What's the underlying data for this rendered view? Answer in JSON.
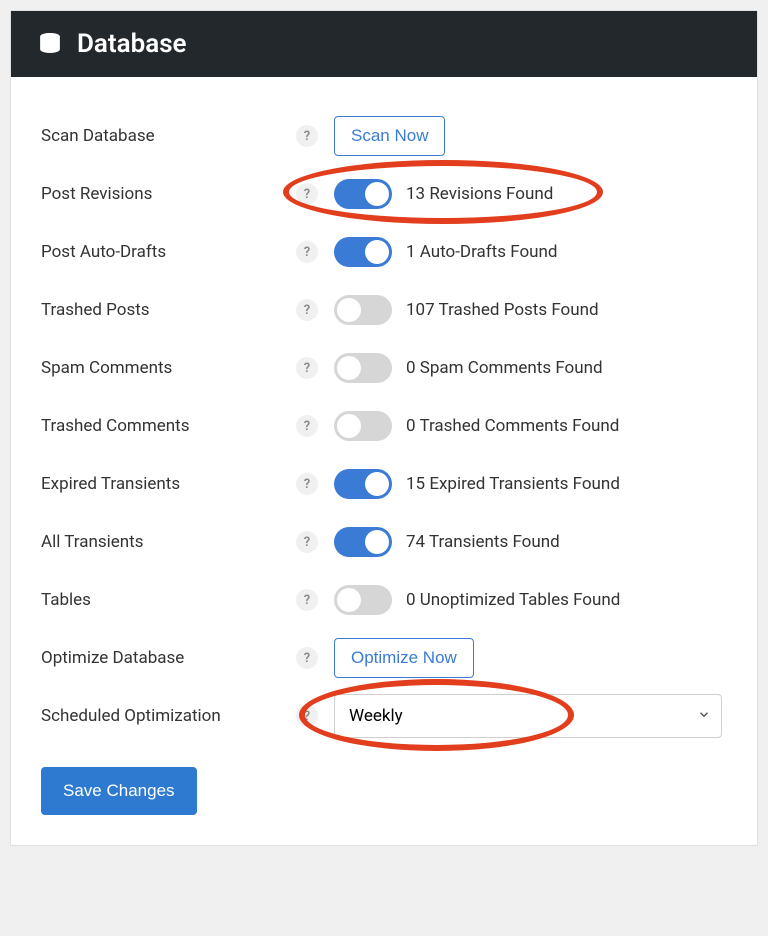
{
  "header": {
    "title": "Database"
  },
  "rows": {
    "scan": {
      "label": "Scan Database",
      "button": "Scan Now"
    },
    "revisions": {
      "label": "Post Revisions",
      "status": "13 Revisions Found",
      "on": true
    },
    "autodrafts": {
      "label": "Post Auto-Drafts",
      "status": "1 Auto-Drafts Found",
      "on": true
    },
    "trashed": {
      "label": "Trashed Posts",
      "status": "107 Trashed Posts Found",
      "on": false
    },
    "spam": {
      "label": "Spam Comments",
      "status": "0 Spam Comments Found",
      "on": false
    },
    "tcomments": {
      "label": "Trashed Comments",
      "status": "0 Trashed Comments Found",
      "on": false
    },
    "exptrans": {
      "label": "Expired Transients",
      "status": "15 Expired Transients Found",
      "on": true
    },
    "alltrans": {
      "label": "All Transients",
      "status": "74 Transients Found",
      "on": true
    },
    "tables": {
      "label": "Tables",
      "status": "0 Unoptimized Tables Found",
      "on": false
    },
    "optimize": {
      "label": "Optimize Database",
      "button": "Optimize Now"
    },
    "schedule": {
      "label": "Scheduled Optimization",
      "value": "Weekly"
    }
  },
  "actions": {
    "save": "Save Changes"
  },
  "help_glyph": "?"
}
